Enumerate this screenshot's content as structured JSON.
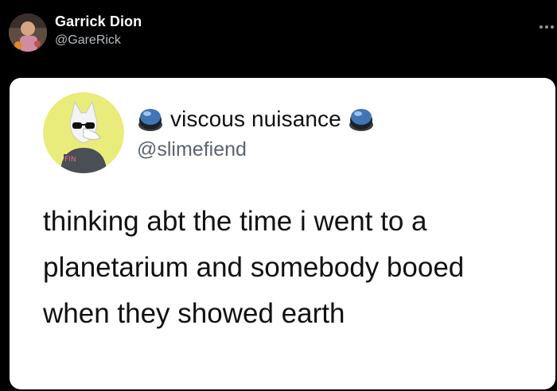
{
  "outer_tweet": {
    "display_name": "Garrick Dion",
    "handle": "@GareRick",
    "avatar": "profile-photo",
    "more_icon": "more-dots-icon"
  },
  "quoted_tweet": {
    "display_name": "viscous nuisance",
    "handle": "@slimefiend",
    "avatar": "wolf-cartoon-avatar",
    "name_icons": [
      "round-button-icon",
      "round-button-icon"
    ],
    "text_lines": [
      "thinking abt the time i went to a",
      "planetarium and somebody booed",
      "when they showed earth"
    ]
  },
  "colors": {
    "background": "#000000",
    "card": "#ffffff",
    "avatar_circle": "#e9ec7a"
  }
}
